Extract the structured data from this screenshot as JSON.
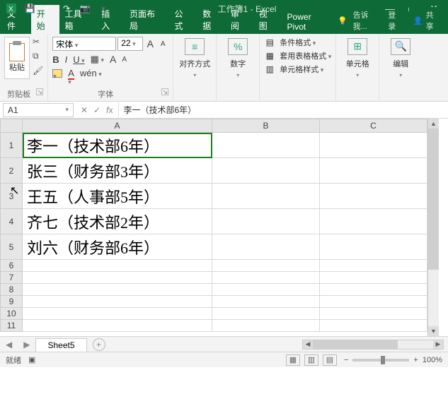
{
  "app": {
    "title": "工作簿1 - Excel"
  },
  "tabs": {
    "file": "文件",
    "home": "开始",
    "toolbox": "工具箱",
    "insert": "插入",
    "pagelayout": "页面布局",
    "formulas": "公式",
    "data": "数据",
    "review": "审阅",
    "view": "视图",
    "powerpivot": "Power Pivot",
    "tellme": "告诉我...",
    "signin": "登录",
    "share": "共享"
  },
  "ribbon": {
    "clipboard": {
      "label": "剪贴板",
      "paste": "粘贴"
    },
    "font": {
      "label": "字体",
      "name": "宋体",
      "size": "22"
    },
    "alignment": {
      "label": "对齐方式"
    },
    "number": {
      "label": "数字",
      "percent": "%"
    },
    "styles": {
      "conditional": "条件格式",
      "table": "套用表格格式",
      "cell": "单元格样式"
    },
    "cells": {
      "label": "单元格"
    },
    "editing": {
      "label": "编辑"
    }
  },
  "namebox": "A1",
  "formula": "李一（技术部6年）",
  "columns": [
    "A",
    "B",
    "C"
  ],
  "rows": {
    "tall": [
      1,
      2,
      3,
      4,
      5
    ],
    "short": [
      6,
      7,
      8,
      9,
      10,
      11
    ]
  },
  "cells": {
    "A1": "李一（技术部6年）",
    "A2": "张三（财务部3年）",
    "A3": "王五（人事部5年）",
    "A4": "齐七（技术部2年）",
    "A5": "刘六（财务部6年）"
  },
  "sheet": {
    "active": "Sheet5"
  },
  "status": {
    "ready": "就绪",
    "zoom": "100%"
  },
  "chart_data": null
}
